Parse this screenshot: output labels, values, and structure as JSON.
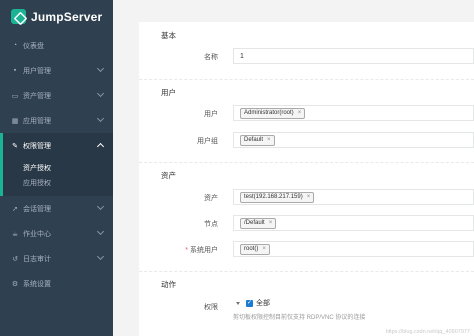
{
  "app": {
    "title": "JumpServer"
  },
  "sidebar": {
    "items": [
      {
        "label": "仪表盘",
        "icon": "dashboard-icon",
        "expandable": false
      },
      {
        "label": "用户管理",
        "icon": "users-icon",
        "expandable": true
      },
      {
        "label": "资产管理",
        "icon": "inbox-icon",
        "expandable": true
      },
      {
        "label": "应用管理",
        "icon": "grid-icon",
        "expandable": true
      },
      {
        "label": "权限管理",
        "icon": "edit-icon",
        "expandable": true,
        "active": true
      },
      {
        "label": "会话管理",
        "icon": "rocket-icon",
        "expandable": true
      },
      {
        "label": "作业中心",
        "icon": "coffee-icon",
        "expandable": true
      },
      {
        "label": "日志审计",
        "icon": "history-icon",
        "expandable": true
      },
      {
        "label": "系统设置",
        "icon": "gear-icon",
        "expandable": false
      }
    ],
    "permission_sub": [
      {
        "label": "资产授权",
        "active": true
      },
      {
        "label": "应用授权",
        "active": false
      }
    ]
  },
  "form": {
    "sections": {
      "basic": "基本",
      "user": "用户",
      "asset": "资产",
      "action": "动作"
    },
    "name": {
      "label": "名称",
      "value": "1"
    },
    "users": {
      "label": "用户",
      "tags": [
        "Administrator(root)"
      ]
    },
    "user_groups": {
      "label": "用户组",
      "tags": [
        "Default"
      ]
    },
    "assets": {
      "label": "资产",
      "tags": [
        "test(192.168.217.159)"
      ]
    },
    "nodes": {
      "label": "节点",
      "tags": [
        "/Default"
      ]
    },
    "system_users": {
      "label": "系统用户",
      "required_mark": "*",
      "tags": [
        "root()"
      ]
    },
    "actions": {
      "label": "权限",
      "checkbox_label": "全部",
      "checked": true,
      "help": "剪切板权限控制目前仅支持 RDP/VNC 协议的连接"
    }
  },
  "tag_remove_glyph": "×",
  "watermark": "https://blog.csdn.net/qq_40907977",
  "colors": {
    "sidebar_bg": "#2f4050",
    "accent": "#1ab394",
    "checkbox": "#1a7bd0"
  }
}
